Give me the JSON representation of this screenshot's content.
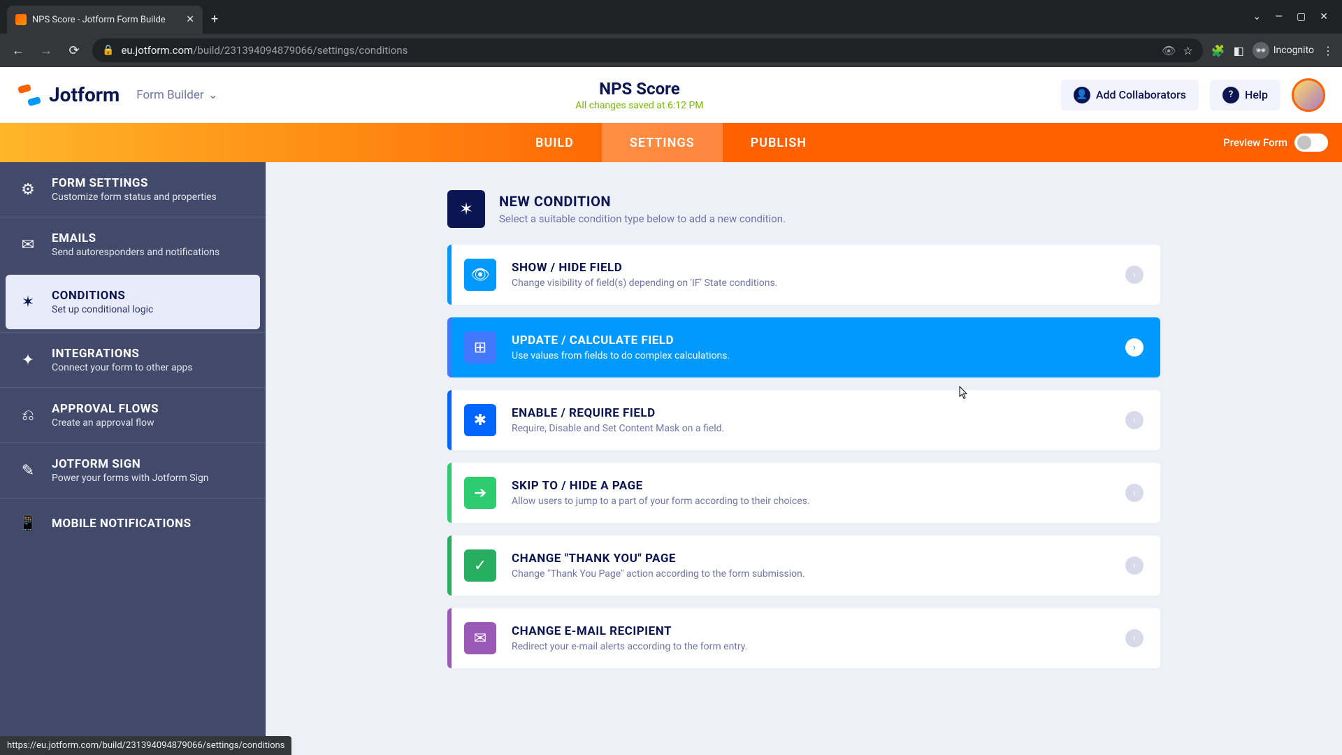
{
  "browser": {
    "tab_title": "NPS Score - Jotform Form Builde",
    "url_domain": "eu.jotform.com",
    "url_path": "/build/231394094879066/settings/conditions",
    "incognito_label": "Incognito",
    "status_url": "https://eu.jotform.com/build/231394094879066/settings/conditions"
  },
  "header": {
    "logo_text": "Jotform",
    "form_builder_label": "Form Builder",
    "title": "NPS Score",
    "saved_text": "All changes saved at 6:12 PM",
    "collab_label": "Add Collaborators",
    "help_label": "Help"
  },
  "tabs": {
    "build": "BUILD",
    "settings": "SETTINGS",
    "publish": "PUBLISH",
    "preview_label": "Preview Form"
  },
  "sidebar": [
    {
      "title": "FORM SETTINGS",
      "desc": "Customize form status and properties"
    },
    {
      "title": "EMAILS",
      "desc": "Send autoresponders and notifications"
    },
    {
      "title": "CONDITIONS",
      "desc": "Set up conditional logic"
    },
    {
      "title": "INTEGRATIONS",
      "desc": "Connect your form to other apps"
    },
    {
      "title": "APPROVAL FLOWS",
      "desc": "Create an approval flow"
    },
    {
      "title": "JOTFORM SIGN",
      "desc": "Power your forms with Jotform Sign"
    },
    {
      "title": "MOBILE NOTIFICATIONS",
      "desc": ""
    }
  ],
  "new_condition": {
    "title": "NEW CONDITION",
    "desc": "Select a suitable condition type below to add a new condition."
  },
  "conditions": [
    {
      "title": "SHOW / HIDE FIELD",
      "desc": "Change visibility of field(s) depending on 'IF' State conditions."
    },
    {
      "title": "UPDATE / CALCULATE FIELD",
      "desc": "Use values from fields to do complex calculations."
    },
    {
      "title": "ENABLE / REQUIRE FIELD",
      "desc": "Require, Disable and Set Content Mask on a field."
    },
    {
      "title": "SKIP TO / HIDE A PAGE",
      "desc": "Allow users to jump to a part of your form according to their choices."
    },
    {
      "title": "CHANGE \"THANK YOU\" PAGE",
      "desc": "Change \"Thank You Page\" action according to the form submission."
    },
    {
      "title": "CHANGE E-MAIL RECIPIENT",
      "desc": "Redirect your e-mail alerts according to the form entry."
    }
  ]
}
